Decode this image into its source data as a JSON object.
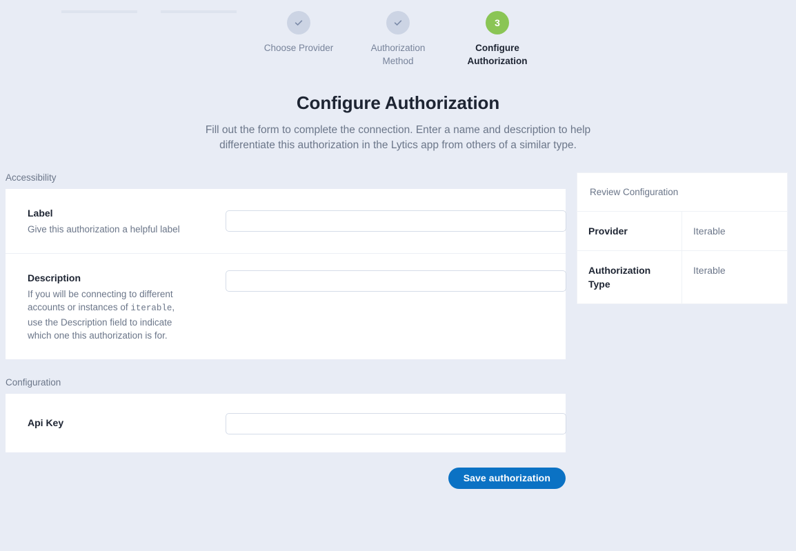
{
  "stepper": {
    "steps": [
      {
        "label": "Choose Provider",
        "state": "done",
        "marker": "check-icon"
      },
      {
        "label": "Authorization Method",
        "state": "done",
        "marker": "check-icon"
      },
      {
        "label": "Configure Authorization",
        "state": "active",
        "marker": "3"
      }
    ],
    "active_color": "#8ac555",
    "done_color": "#ccd4e4",
    "connector_color": "#dde3ee"
  },
  "header": {
    "title": "Configure Authorization",
    "subtitle": "Fill out the form to complete the connection. Enter a name and description to help differentiate this authorization in the Lytics app from others of a similar type."
  },
  "sections": {
    "accessibility": {
      "label": "Accessibility",
      "fields": [
        {
          "title": "Label",
          "help": "Give this authorization a helpful label",
          "value": "",
          "placeholder": ""
        },
        {
          "title": "Description",
          "help_part1": "If you will be connecting to different accounts or instances of",
          "help_code": "iterable",
          "help_part2": ", use the Description field to indicate which one this authorization is for.",
          "value": "",
          "placeholder": ""
        }
      ]
    },
    "configuration": {
      "label": "Configuration",
      "fields": [
        {
          "title": "Api Key",
          "value": "",
          "placeholder": ""
        }
      ]
    }
  },
  "review": {
    "heading": "Review Configuration",
    "rows": [
      {
        "key": "Provider",
        "value": "Iterable"
      },
      {
        "key": "Authorization Type",
        "value": "Iterable"
      }
    ]
  },
  "actions": {
    "save_label": "Save authorization",
    "save_color": "#0b72c4"
  }
}
